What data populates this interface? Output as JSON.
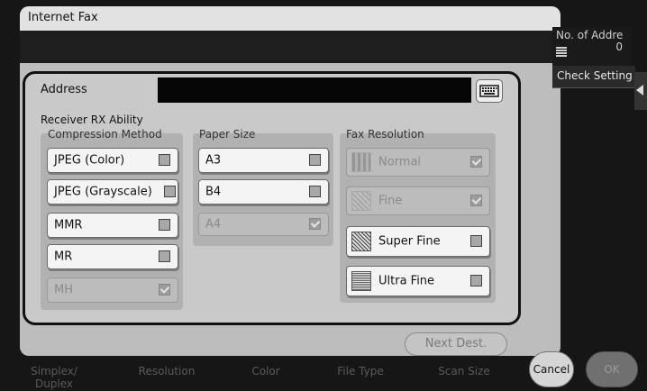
{
  "window": {
    "title": "Internet Fax"
  },
  "address": {
    "label": "Address",
    "value": ""
  },
  "receiver": {
    "label": "Receiver RX Ability",
    "compression": {
      "title": "Compression Method",
      "options": [
        {
          "label": "JPEG (Color)",
          "checked": false,
          "enabled": true
        },
        {
          "label": "JPEG (Grayscale)",
          "checked": false,
          "enabled": true
        },
        {
          "label": "MMR",
          "checked": false,
          "enabled": true
        },
        {
          "label": "MR",
          "checked": false,
          "enabled": true
        },
        {
          "label": "MH",
          "checked": true,
          "enabled": false
        }
      ]
    },
    "paper_size": {
      "title": "Paper Size",
      "options": [
        {
          "label": "A3",
          "checked": false,
          "enabled": true
        },
        {
          "label": "B4",
          "checked": false,
          "enabled": true
        },
        {
          "label": "A4",
          "checked": true,
          "enabled": false
        }
      ]
    },
    "fax_resolution": {
      "title": "Fax Resolution",
      "options": [
        {
          "label": "Normal",
          "checked": true,
          "enabled": false,
          "icon": "normal-resolution-icon"
        },
        {
          "label": "Fine",
          "checked": true,
          "enabled": false,
          "icon": "fine-resolution-icon"
        },
        {
          "label": "Super Fine",
          "checked": false,
          "enabled": true,
          "icon": "super-fine-resolution-icon"
        },
        {
          "label": "Ultra Fine",
          "checked": false,
          "enabled": true,
          "icon": "ultra-fine-resolution-icon"
        }
      ]
    }
  },
  "right_panel": {
    "no_of_address_label": "No. of Addre",
    "no_of_address_count": "0",
    "check_setting_label": "Check Setting"
  },
  "footer": {
    "next_dest_label": "Next Dest.",
    "cancel_label": "Cancel",
    "ok_label": "OK"
  },
  "bottom_tabs": [
    "Simplex/\nDuplex",
    "Resolution",
    "Color",
    "File Type",
    "Scan Size"
  ]
}
